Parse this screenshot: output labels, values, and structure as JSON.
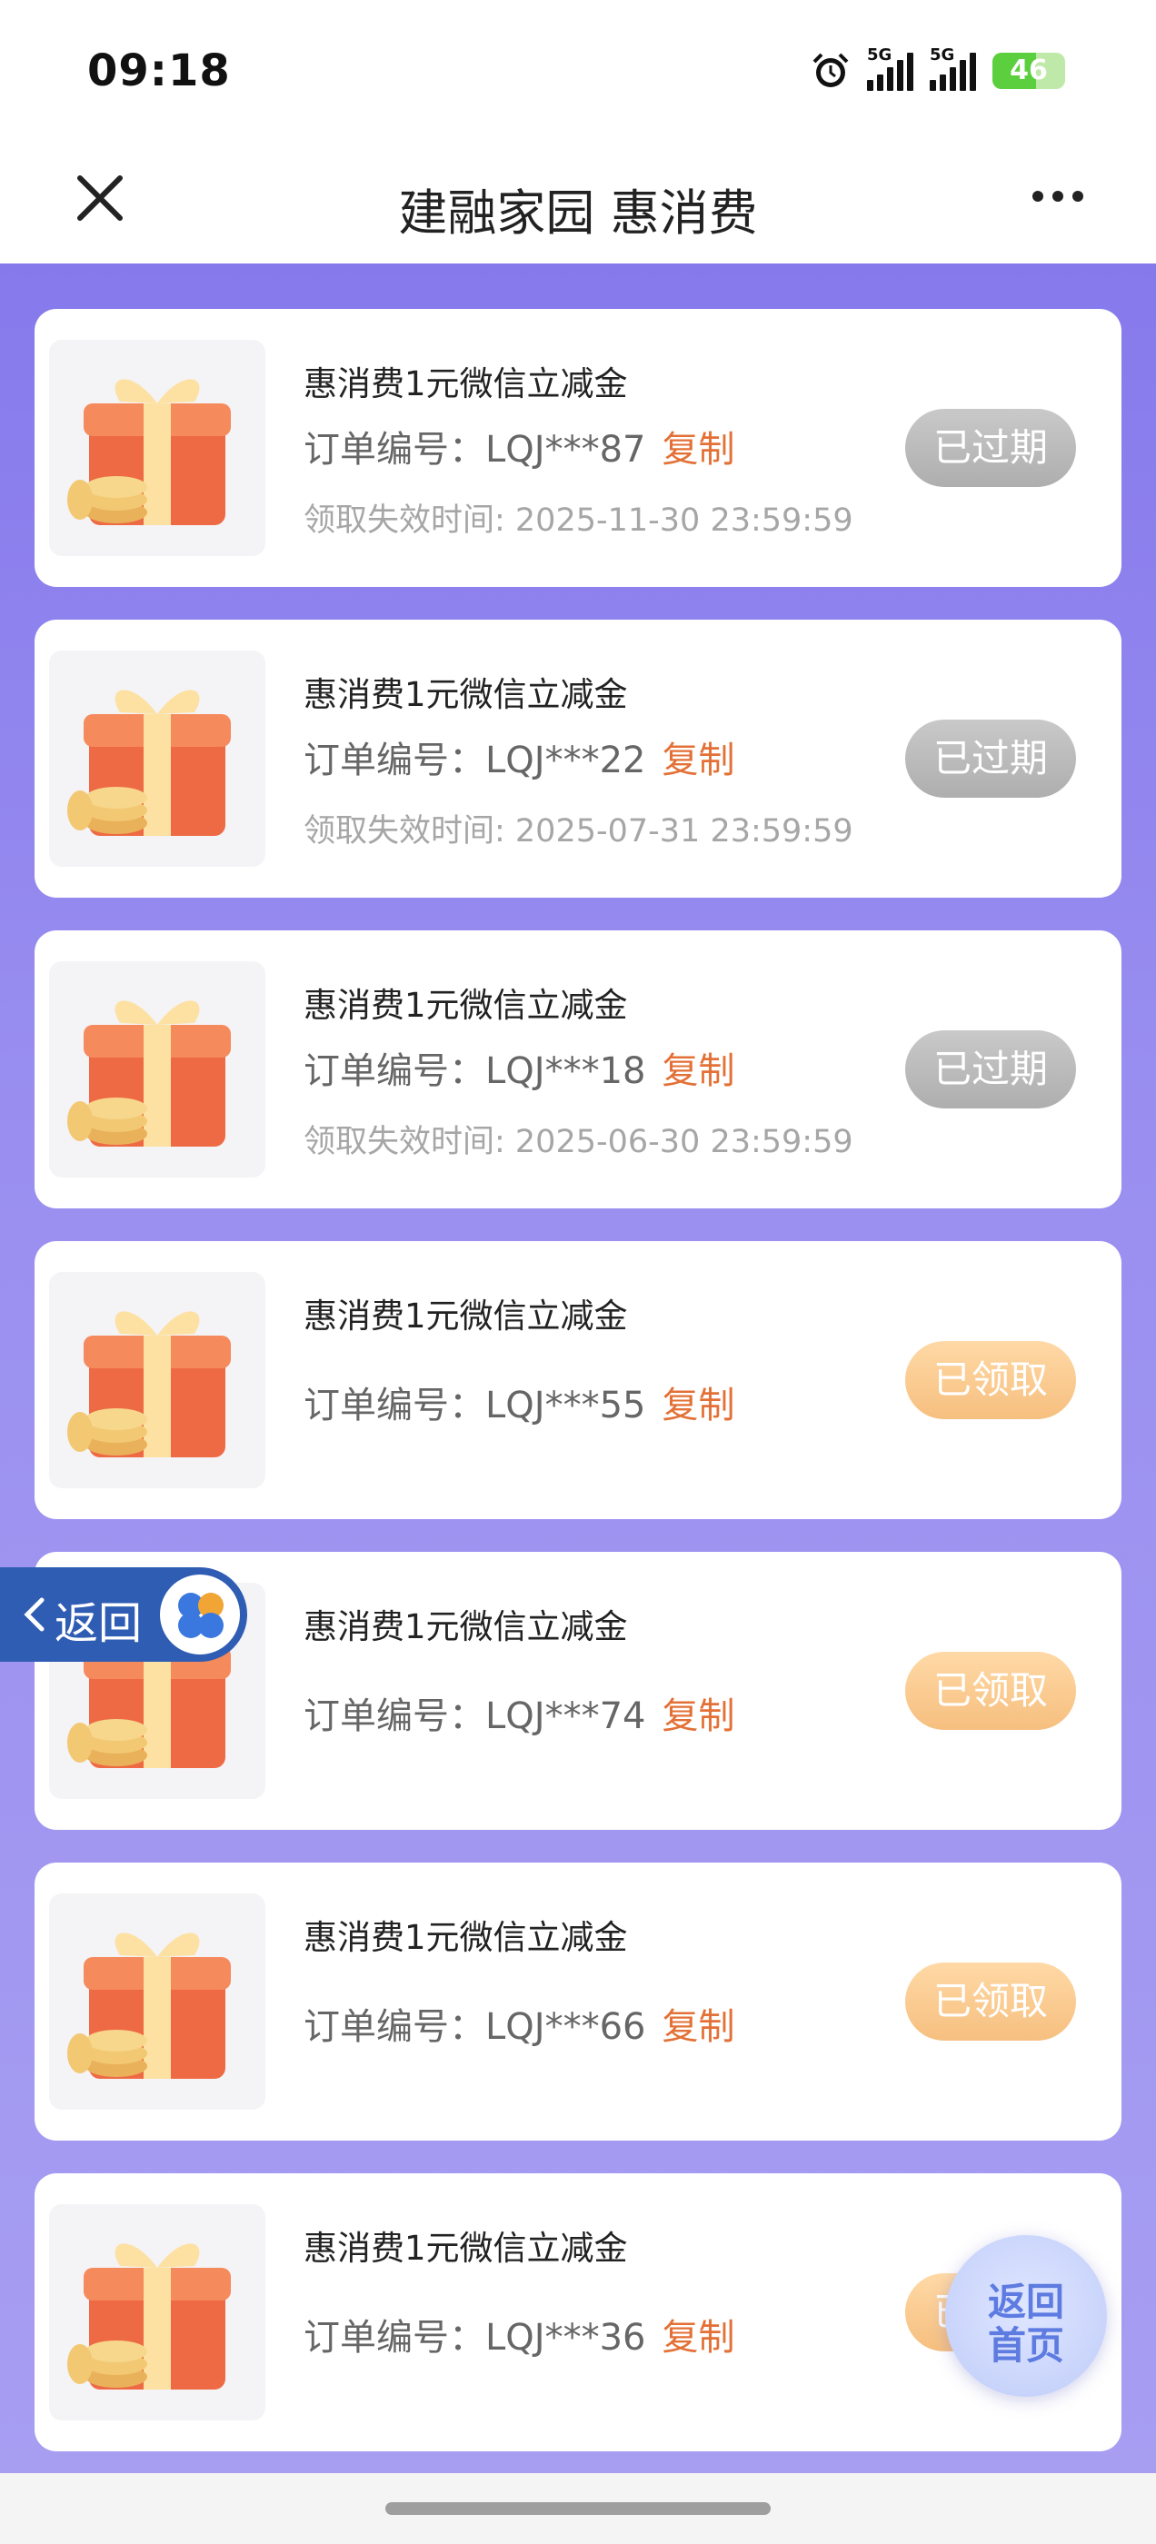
{
  "status_bar": {
    "time": "09:18",
    "network_label": "5G",
    "network_label_2": "5G",
    "battery": "46",
    "icons": [
      "alarm-icon",
      "signal-icon",
      "signal-icon",
      "battery-icon"
    ]
  },
  "header": {
    "title": "建融家园 惠消费",
    "close_icon": "close-icon",
    "more_icon": "more-icon"
  },
  "cards": [
    {
      "title": "惠消费1元微信立减金",
      "order_label": "订单编号：",
      "order_no": "LQJ***87",
      "copy": "复制",
      "expiry": "领取失效时间: 2025-11-30 23:59:59",
      "status": "已过期"
    },
    {
      "title": "惠消费1元微信立减金",
      "order_label": "订单编号：",
      "order_no": "LQJ***22",
      "copy": "复制",
      "expiry": "领取失效时间: 2025-07-31 23:59:59",
      "status": "已过期"
    },
    {
      "title": "惠消费1元微信立减金",
      "order_label": "订单编号：",
      "order_no": "LQJ***18",
      "copy": "复制",
      "expiry": "领取失效时间: 2025-06-30 23:59:59",
      "status": "已过期"
    },
    {
      "title": "惠消费1元微信立减金",
      "order_label": "订单编号：",
      "order_no": "LQJ***55",
      "copy": "复制",
      "expiry": "",
      "status": "已领取"
    },
    {
      "title": "惠消费1元微信立减金",
      "order_label": "订单编号：",
      "order_no": "LQJ***74",
      "copy": "复制",
      "expiry": "",
      "status": "已领取"
    },
    {
      "title": "惠消费1元微信立减金",
      "order_label": "订单编号：",
      "order_no": "LQJ***66",
      "copy": "复制",
      "expiry": "",
      "status": "已领取"
    },
    {
      "title": "惠消费1元微信立减金",
      "order_label": "订单编号：",
      "order_no": "LQJ***36",
      "copy": "复制",
      "expiry": "",
      "status": "已领取"
    }
  ],
  "float_back": {
    "label": "返回",
    "icon": "chevron-left-icon"
  },
  "home_button": {
    "line1": "返回",
    "line2": "首页"
  },
  "colors": {
    "accent_copy": "#e37036",
    "expired_button": "#b8b8b8",
    "claimed_button": "#f6c186",
    "background_gradient_top": "#8679ec",
    "background_gradient_bottom": "#a79ef2"
  }
}
